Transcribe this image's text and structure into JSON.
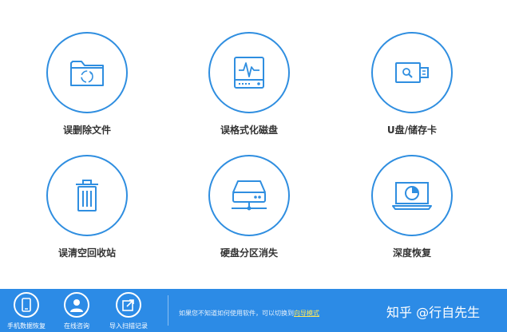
{
  "tiles": [
    {
      "label": "误删除文件",
      "icon": "folder-recycle-icon"
    },
    {
      "label": "误格式化磁盘",
      "icon": "disk-pulse-icon"
    },
    {
      "label": "U盘/储存卡",
      "icon": "usb-drive-icon"
    },
    {
      "label": "误清空回收站",
      "icon": "trash-bin-icon"
    },
    {
      "label": "硬盘分区消失",
      "icon": "hard-drive-network-icon"
    },
    {
      "label": "深度恢复",
      "icon": "monitor-scan-icon"
    }
  ],
  "footer": {
    "buttons": [
      {
        "label": "手机数据恢复",
        "icon": "phone-icon"
      },
      {
        "label": "在线咨询",
        "icon": "user-icon"
      },
      {
        "label": "导入扫描记录",
        "icon": "import-icon"
      }
    ],
    "hint_text": "如果您不知道如何使用软件，可以切换到",
    "hint_link": "向导模式",
    "watermark": "知乎 @行自先生"
  },
  "colors": {
    "accent": "#2f8ee0",
    "footer_bg": "#2c8be6",
    "link": "#ffe95a"
  }
}
